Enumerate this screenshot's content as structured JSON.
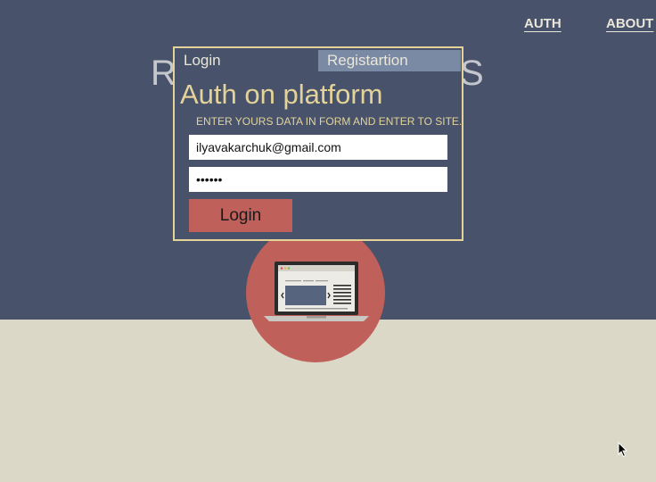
{
  "nav": {
    "auth_label": "AUTH",
    "about_label": "ABOUT"
  },
  "hero": {
    "left_char": "R",
    "right_char": "S"
  },
  "modal": {
    "tab_login": "Login",
    "tab_register": "Registartion",
    "title": "Auth on platform",
    "subtitle": "ENTER YOURS DATA IN FORM AND ENTER TO SITE.",
    "email_value": "ilyavakarchuk@gmail.com",
    "password_value": "••••••",
    "login_button": "Login"
  },
  "colors": {
    "header_bg": "#48536b",
    "page_bg": "#dcd8c8",
    "accent": "#e3d399",
    "button": "#c0605a",
    "active_tab": "#7a8aa5"
  }
}
